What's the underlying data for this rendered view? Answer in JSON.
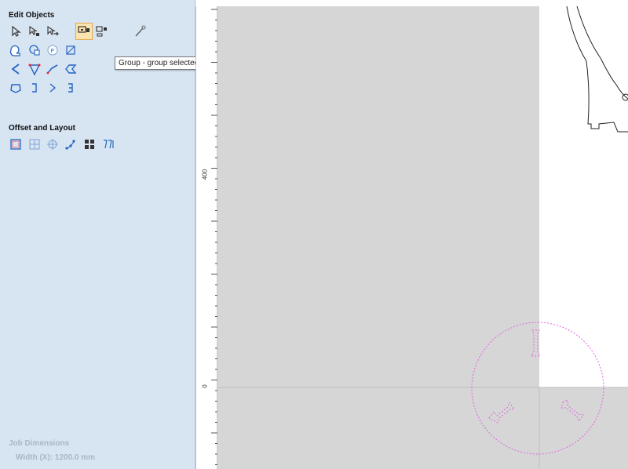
{
  "sidebar": {
    "edit_objects_title": "Edit Objects",
    "offset_layout_title": "Offset and Layout",
    "tooltip": "Group - group selected objects",
    "job_dimensions_title": "Job Dimensions",
    "width_label": "Width",
    "width_symbol": "(X):",
    "width_value": "1200.0 mm",
    "edit_tools": [
      {
        "name": "select-icon"
      },
      {
        "name": "node-edit-icon"
      },
      {
        "name": "transform-icon"
      },
      {
        "name": "group-icon",
        "active": true
      },
      {
        "name": "ungroup-icon"
      },
      {
        "name": "measure-icon"
      },
      {
        "name": "weld-icon"
      },
      {
        "name": "subtract-icon"
      },
      {
        "name": "trim-icon"
      },
      {
        "name": "boolean-icon"
      },
      {
        "name": "smooth-icon"
      },
      {
        "name": "close-vector-icon"
      },
      {
        "name": "chevron-icon"
      },
      {
        "name": "heart-icon"
      },
      {
        "name": "check-curve-icon"
      },
      {
        "name": "diamond-arrow-icon"
      },
      {
        "name": "polygon-icon"
      },
      {
        "name": "bracket-left-icon"
      },
      {
        "name": "bracket-right-icon"
      },
      {
        "name": "bracket-join-icon"
      }
    ],
    "layout_tools": [
      {
        "name": "offset-icon"
      },
      {
        "name": "grid-layout-icon"
      },
      {
        "name": "circular-layout-icon"
      },
      {
        "name": "path-array-icon"
      },
      {
        "name": "nest-icon"
      },
      {
        "name": "fit-icon"
      }
    ]
  },
  "ruler": {
    "labels": [
      "400",
      "0"
    ]
  },
  "colors": {
    "sidebar_bg": "#d7e4f2",
    "canvas_bg": "#d6d6d6",
    "material_bg": "#ffffff",
    "vector_dotted": "#e066e0",
    "vector_solid": "#222222",
    "group_highlight": "#fbe3b0"
  }
}
